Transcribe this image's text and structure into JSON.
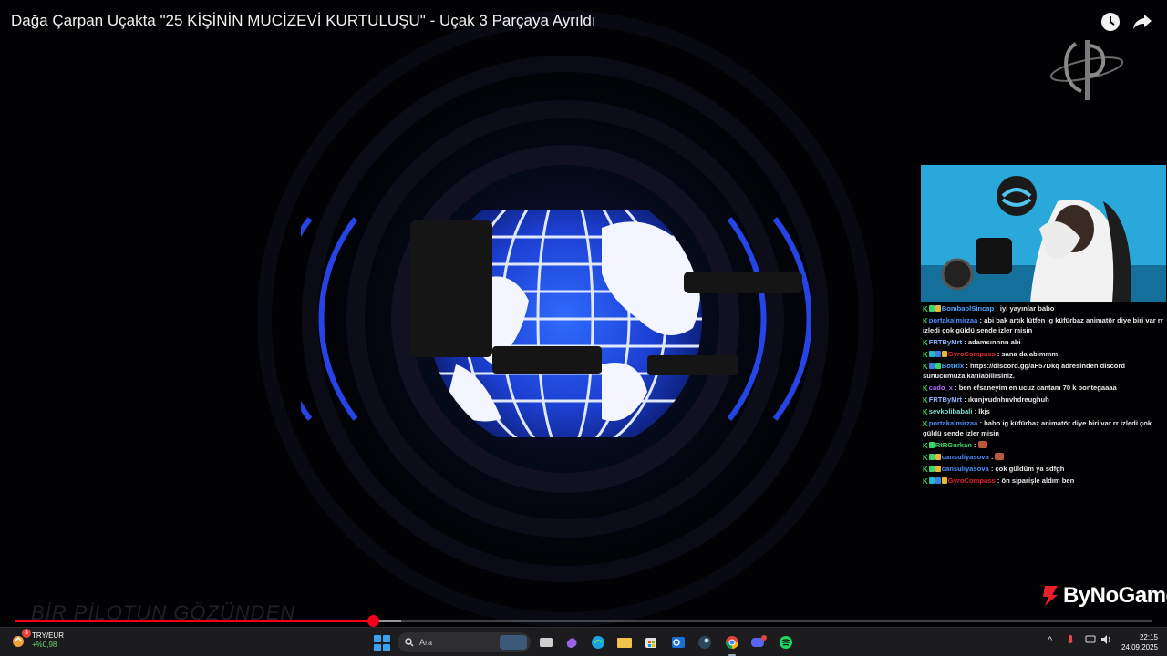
{
  "video": {
    "title": "Dağa Çarpan Uçakta \"25 KİŞİNİN MUCİZEVİ KURTULUŞU\" - Uçak 3 Parçaya Ayrıldı",
    "watermark": "BİR PİLOTUN GÖZÜNDEN",
    "sponsor": "ByNoGame",
    "progress": 0.315,
    "buffered": 0.34
  },
  "chat": [
    {
      "badges": [
        "k",
        "green",
        "gold"
      ],
      "user": "BombaolSincap",
      "color": "#4fa3ff",
      "text": "iyi yayınlar babo"
    },
    {
      "badges": [
        "k"
      ],
      "user": "portakalmirzaa",
      "color": "#4f8bff",
      "text": "abi bak artık lütfen ig küfürbaz animatör diye biri var rr izledi çok güldü sende izler misin"
    },
    {
      "badges": [
        "k"
      ],
      "user": "FRTByMrt",
      "color": "#8fb4ff",
      "text": "adamsınnnn abi"
    },
    {
      "badges": [
        "k",
        "teal",
        "blue",
        "gold"
      ],
      "user": "GyroCompass",
      "color": "#e0252f",
      "text": "sana da abimmm"
    },
    {
      "badges": [
        "k",
        "blue",
        "green"
      ],
      "user": "BotRix",
      "color": "#4fa3ff",
      "text": "https://discord.gg/aF57Dkq adresinden discord sunucumuza katılabilirsiniz."
    },
    {
      "badges": [
        "k"
      ],
      "user": "cado_x",
      "color": "#b16bff",
      "text": "ben efsaneyim en ucuz cantam 70 k bontegaaaa"
    },
    {
      "badges": [
        "k"
      ],
      "user": "FRTByMrt",
      "color": "#8fb4ff",
      "text": "ıkunjvudnhuvhdreughuh"
    },
    {
      "badges": [
        "k"
      ],
      "user": "sevkolibabali",
      "color": "#7fdfd4",
      "text": "lkjs"
    },
    {
      "badges": [
        "k"
      ],
      "user": "portakalmirzaa",
      "color": "#4f8bff",
      "text": "babo ig küfürbaz animatör diye biri var rr izledi çok güldü sende izler misin"
    },
    {
      "badges": [
        "k",
        "green"
      ],
      "user": "RtRGurkan",
      "color": "#3ad46a",
      "text": "",
      "emote": true
    },
    {
      "badges": [
        "k",
        "green",
        "gold"
      ],
      "user": "cansuliyasova",
      "color": "#4f8bff",
      "text": "",
      "emote": true
    },
    {
      "badges": [
        "k",
        "green",
        "gold"
      ],
      "user": "cansuliyasova",
      "color": "#4f8bff",
      "text": "çok güldüm ya sdfgh"
    },
    {
      "badges": [
        "k",
        "teal",
        "blue",
        "gold"
      ],
      "user": "GyroCompass",
      "color": "#e0252f",
      "text": "ön siparişle aldım ben"
    }
  ],
  "taskbar": {
    "widget_title": "TRY/EUR",
    "widget_change": "+%0,98",
    "widget_badge": "3",
    "search_placeholder": "Ara",
    "time": "22:15",
    "date": "24.09.2025",
    "apps": [
      "file-explorer-app",
      "copilot-app",
      "edge-app",
      "folder-app",
      "store-app",
      "outlook-app",
      "steam-app",
      "chrome-app",
      "discord-app",
      "spotify-app"
    ]
  }
}
